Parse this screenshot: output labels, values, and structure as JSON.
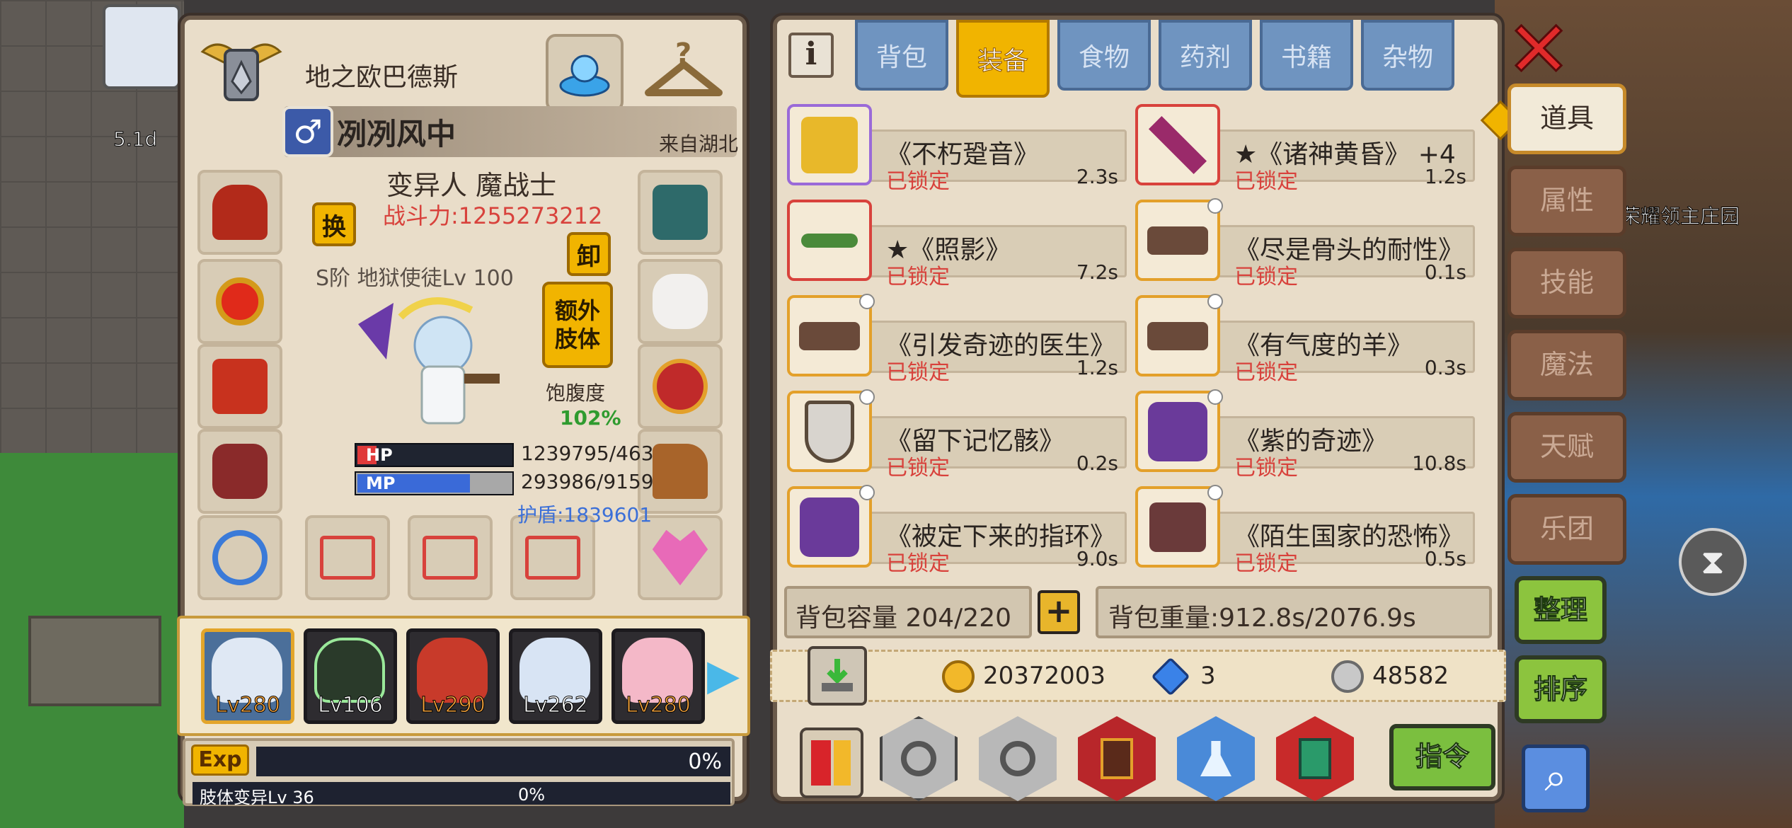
{
  "character": {
    "rank_title": "地之欧巴德斯",
    "player_name": "冽冽风中",
    "origin": "来自湖北",
    "class": "变异人 魔战士",
    "combat_power": "战斗力:1255273212",
    "swap_label": "换",
    "unequip_label": "卸",
    "weapon_label": "S阶 地狱使徒Lv 100",
    "extra_limb_line1": "额外",
    "extra_limb_line2": "肢体",
    "satiety_label": "饱腹度",
    "satiety_value": "102%",
    "hp_label": "HP",
    "mp_label": "MP",
    "hp_value": "1239795/463",
    "mp_value": "293986/9159",
    "hp_fraction": 0.12,
    "mp_fraction": 0.72,
    "shield": "护盾:1839601"
  },
  "party": [
    {
      "level": "Lv280",
      "color": "orange",
      "selected": true
    },
    {
      "level": "Lv106",
      "color": "white",
      "selected": false
    },
    {
      "level": "Lv290",
      "color": "orange",
      "selected": false
    },
    {
      "level": "Lv262",
      "color": "white",
      "selected": false
    },
    {
      "level": "Lv280",
      "color": "orange",
      "selected": false
    }
  ],
  "exp": {
    "badge": "Exp",
    "percent": "0%",
    "limb_label": "肢体变异Lv 36",
    "limb_percent": "0%"
  },
  "inventory": {
    "info_label": "i",
    "tabs": [
      "背包",
      "装备",
      "食物",
      "药剂",
      "书籍",
      "杂物"
    ],
    "active_tab": 1,
    "items": [
      {
        "name": "《不朽跫音》",
        "status": "已锁定",
        "time": "2.3s",
        "icon": "golden-boots-icon"
      },
      {
        "name": "★《诸神黄昏》 +4",
        "status": "已锁定",
        "time": "1.2s",
        "icon": "purple-sword-icon"
      },
      {
        "name": "★《照影》",
        "status": "已锁定",
        "time": "7.2s",
        "icon": "crossbow-icon"
      },
      {
        "name": "《尽是骨头的耐性》",
        "status": "已锁定",
        "time": "0.1s",
        "icon": "bone-boots-icon"
      },
      {
        "name": "《引发奇迹的医生》",
        "status": "已锁定",
        "time": "1.2s",
        "icon": "bone-boots-icon"
      },
      {
        "name": "《有气度的羊》",
        "status": "已锁定",
        "time": "0.3s",
        "icon": "bone-boots-icon"
      },
      {
        "name": "《留下记忆骸》",
        "status": "已锁定",
        "time": "0.2s",
        "icon": "shield-icon"
      },
      {
        "name": "《紫的奇迹》",
        "status": "已锁定",
        "time": "10.8s",
        "icon": "purple-armor-icon"
      },
      {
        "name": "《被定下来的指环》",
        "status": "已锁定",
        "time": "9.0s",
        "icon": "purple-armor-icon"
      },
      {
        "name": "《陌生国家的恐怖》",
        "status": "已锁定",
        "time": "0.5s",
        "icon": "boots-icon"
      }
    ],
    "capacity": "背包容量 204/220",
    "plus_label": "+",
    "weight": "背包重量:912.8s/2076.9s",
    "gold": "20372003",
    "gems": "3",
    "silver": "48582",
    "command_label": "指令"
  },
  "sidebar": {
    "tabs": [
      "道具",
      "属性",
      "技能",
      "魔法",
      "天赋",
      "乐团"
    ],
    "active": 0,
    "sort_label": "整理",
    "order_label": "排序"
  },
  "world": {
    "map_level": "5.1d",
    "manor_label": "荣耀领主庄园"
  },
  "colors": {
    "panel": "#e9ddc9",
    "tab_blue": "#6f94c0",
    "tab_active": "#f1b400",
    "locked_red": "#d8423c",
    "green_button": "#8cc43e"
  }
}
